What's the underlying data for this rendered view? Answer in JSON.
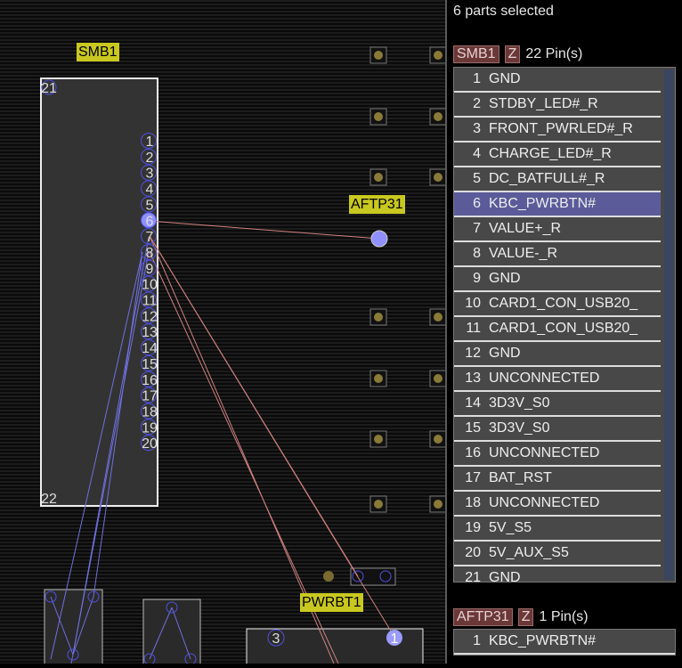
{
  "canvas": {
    "labels": {
      "smb1": "SMB1",
      "aftp31": "AFTP31",
      "pwrbt1": "PWRBT1"
    },
    "smb1_pins": [
      "1",
      "2",
      "3",
      "4",
      "5",
      "6",
      "7",
      "8",
      "9",
      "10",
      "11",
      "12",
      "13",
      "14",
      "15",
      "16",
      "17",
      "18",
      "19",
      "20"
    ],
    "pin21": "21",
    "pin22": "22",
    "pwrbt_pins": [
      "3",
      "1"
    ]
  },
  "panel": {
    "selection_status": "6 parts selected",
    "part1": {
      "name": "SMB1",
      "flag": "Z",
      "pin_count": "22 Pin(s)",
      "pins": [
        {
          "n": "1",
          "net": "GND"
        },
        {
          "n": "2",
          "net": "STDBY_LED#_R"
        },
        {
          "n": "3",
          "net": "FRONT_PWRLED#_R"
        },
        {
          "n": "4",
          "net": "CHARGE_LED#_R"
        },
        {
          "n": "5",
          "net": "DC_BATFULL#_R"
        },
        {
          "n": "6",
          "net": "KBC_PWRBTN#"
        },
        {
          "n": "7",
          "net": "VALUE+_R"
        },
        {
          "n": "8",
          "net": "VALUE-_R"
        },
        {
          "n": "9",
          "net": "GND"
        },
        {
          "n": "10",
          "net": "CARD1_CON_USB20_"
        },
        {
          "n": "11",
          "net": "CARD1_CON_USB20_"
        },
        {
          "n": "12",
          "net": "GND"
        },
        {
          "n": "13",
          "net": "UNCONNECTED"
        },
        {
          "n": "14",
          "net": "3D3V_S0"
        },
        {
          "n": "15",
          "net": "3D3V_S0"
        },
        {
          "n": "16",
          "net": "UNCONNECTED"
        },
        {
          "n": "17",
          "net": "BAT_RST"
        },
        {
          "n": "18",
          "net": "UNCONNECTED"
        },
        {
          "n": "19",
          "net": "5V_S5"
        },
        {
          "n": "20",
          "net": "5V_AUX_S5"
        },
        {
          "n": "21",
          "net": "GND"
        }
      ],
      "selected_index": 5
    },
    "part2": {
      "name": "AFTP31",
      "flag": "Z",
      "pin_count": "1 Pin(s)",
      "pins": [
        {
          "n": "1",
          "net": "KBC_PWRBTN#"
        }
      ]
    }
  }
}
